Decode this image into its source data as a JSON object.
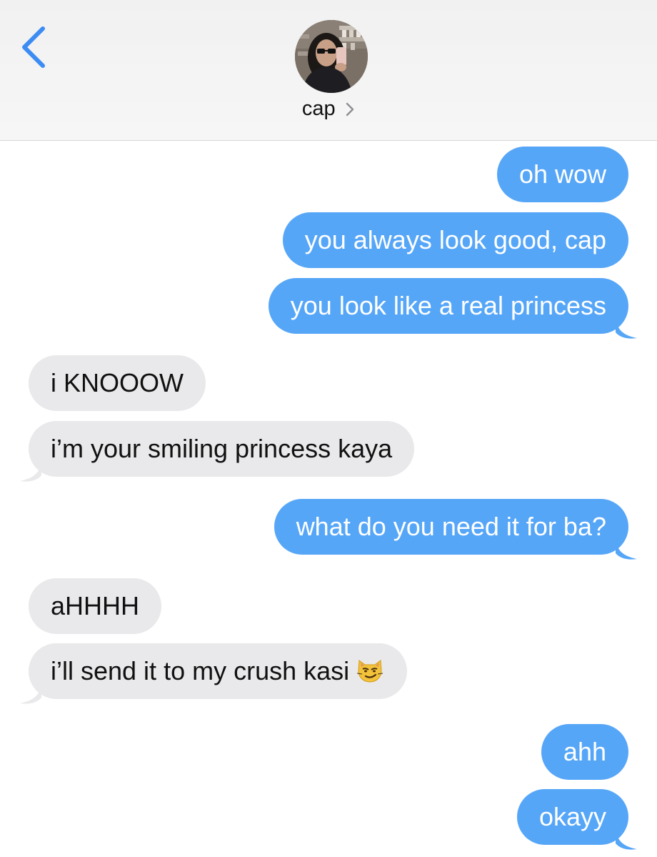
{
  "header": {
    "contact_name": "cap",
    "back_icon": "chevron-left-icon",
    "detail_icon": "chevron-right-icon",
    "accent_color": "#3c8cf3"
  },
  "messages": [
    {
      "direction": "sent",
      "text": "oh wow"
    },
    {
      "direction": "sent",
      "text": "you always look good, cap"
    },
    {
      "direction": "sent",
      "text": "you look like a real princess"
    },
    {
      "direction": "received",
      "text": "i KNOOOW"
    },
    {
      "direction": "received",
      "text": "i’m your smiling princess kaya"
    },
    {
      "direction": "sent",
      "text": "what do you need it for ba?"
    },
    {
      "direction": "received",
      "text": "aHHHH"
    },
    {
      "direction": "received",
      "text": "i’ll send it to my crush kasi",
      "emoji": "smirking-cat-emoji"
    },
    {
      "direction": "sent",
      "text": "ahh"
    },
    {
      "direction": "sent",
      "text": "okayy"
    }
  ],
  "colors": {
    "sent_bubble": "#56a6f8",
    "received_bubble": "#e9e9eb"
  }
}
